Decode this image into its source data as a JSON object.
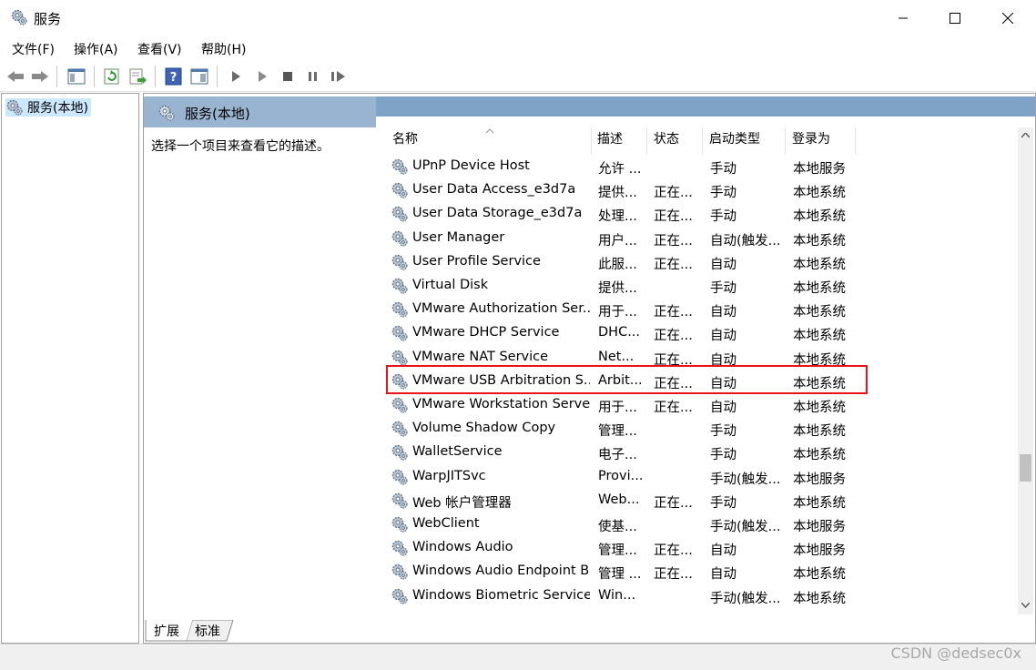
{
  "window": {
    "title": "服务",
    "icon": "gear-icon"
  },
  "menu": [
    "文件(F)",
    "操作(A)",
    "查看(V)",
    "帮助(H)"
  ],
  "tree": {
    "root_label": "服务(本地)"
  },
  "panel": {
    "header_title": "服务(本地)",
    "description_prompt": "选择一个项目来查看它的描述。",
    "columns": [
      "名称",
      "描述",
      "状态",
      "启动类型",
      "登录为"
    ],
    "rows": [
      {
        "name": "UPnP Device Host",
        "desc": "允许 ...",
        "status": "",
        "startup": "手动",
        "logon": "本地服务"
      },
      {
        "name": "User Data Access_e3d7a",
        "desc": "提供...",
        "status": "正在...",
        "startup": "手动",
        "logon": "本地系统"
      },
      {
        "name": "User Data Storage_e3d7a",
        "desc": "处理...",
        "status": "正在...",
        "startup": "手动",
        "logon": "本地系统"
      },
      {
        "name": "User Manager",
        "desc": "用户...",
        "status": "正在...",
        "startup": "自动(触发...",
        "logon": "本地系统"
      },
      {
        "name": "User Profile Service",
        "desc": "此服...",
        "status": "正在...",
        "startup": "自动",
        "logon": "本地系统"
      },
      {
        "name": "Virtual Disk",
        "desc": "提供...",
        "status": "",
        "startup": "手动",
        "logon": "本地系统"
      },
      {
        "name": "VMware Authorization Ser...",
        "desc": "用于...",
        "status": "正在...",
        "startup": "自动",
        "logon": "本地系统"
      },
      {
        "name": "VMware DHCP Service",
        "desc": "DHC...",
        "status": "正在...",
        "startup": "自动",
        "logon": "本地系统"
      },
      {
        "name": "VMware NAT Service",
        "desc": "Net...",
        "status": "正在...",
        "startup": "自动",
        "logon": "本地系统"
      },
      {
        "name": "VMware USB Arbitration S...",
        "desc": "Arbit...",
        "status": "正在...",
        "startup": "自动",
        "logon": "本地系统"
      },
      {
        "name": "VMware Workstation Server",
        "desc": "用于...",
        "status": "正在...",
        "startup": "自动",
        "logon": "本地系统"
      },
      {
        "name": "Volume Shadow Copy",
        "desc": "管理...",
        "status": "",
        "startup": "手动",
        "logon": "本地系统"
      },
      {
        "name": "WalletService",
        "desc": "电子...",
        "status": "",
        "startup": "手动",
        "logon": "本地系统"
      },
      {
        "name": "WarpJITSvc",
        "desc": "Provi...",
        "status": "",
        "startup": "手动(触发...",
        "logon": "本地服务"
      },
      {
        "name": "Web 帐户管理器",
        "desc": "Web...",
        "status": "正在...",
        "startup": "手动",
        "logon": "本地系统"
      },
      {
        "name": "WebClient",
        "desc": "使基...",
        "status": "",
        "startup": "手动(触发...",
        "logon": "本地服务"
      },
      {
        "name": "Windows Audio",
        "desc": "管理...",
        "status": "正在...",
        "startup": "自动",
        "logon": "本地服务"
      },
      {
        "name": "Windows Audio Endpoint B...",
        "desc": "管理 ...",
        "status": "正在...",
        "startup": "自动",
        "logon": "本地系统"
      },
      {
        "name": "Windows Biometric Service",
        "desc": "Win...",
        "status": "",
        "startup": "手动(触发...",
        "logon": "本地系统"
      }
    ]
  },
  "bottom_tabs": [
    "扩展",
    "标准"
  ],
  "watermark": "CSDN @dedsec0x",
  "colors": {
    "header_bg": "#99b4d1",
    "selection": "#cce8ff",
    "highlight_box": "#e8141a"
  }
}
